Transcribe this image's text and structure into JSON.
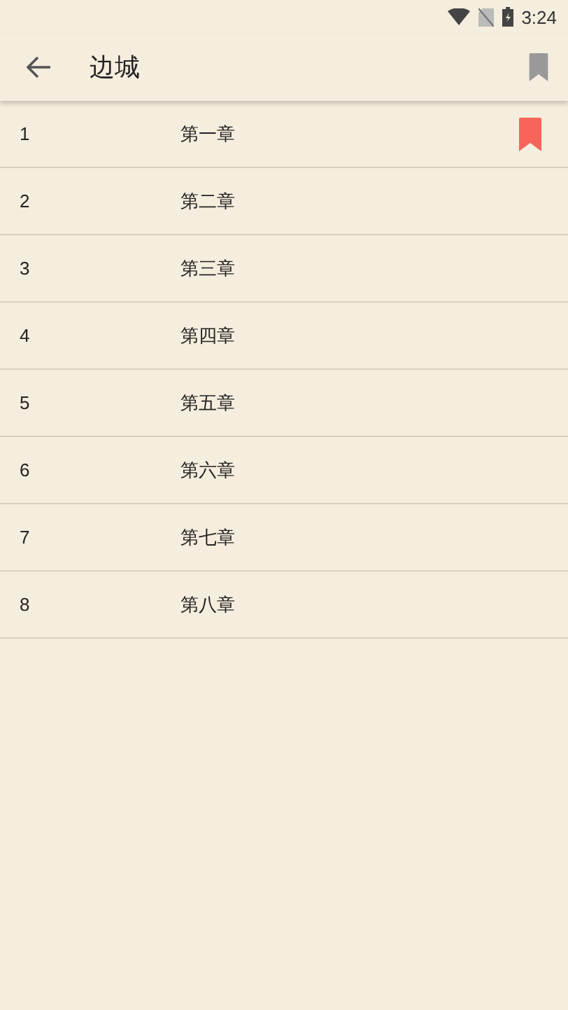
{
  "status_bar": {
    "time": "3:24"
  },
  "app_bar": {
    "title": "边城"
  },
  "chapters": [
    {
      "number": "1",
      "title": "第一章",
      "bookmarked": true
    },
    {
      "number": "2",
      "title": "第二章",
      "bookmarked": false
    },
    {
      "number": "3",
      "title": "第三章",
      "bookmarked": false
    },
    {
      "number": "4",
      "title": "第四章",
      "bookmarked": false
    },
    {
      "number": "5",
      "title": "第五章",
      "bookmarked": false
    },
    {
      "number": "6",
      "title": "第六章",
      "bookmarked": false
    },
    {
      "number": "7",
      "title": "第七章",
      "bookmarked": false
    },
    {
      "number": "8",
      "title": "第八章",
      "bookmarked": false
    }
  ]
}
